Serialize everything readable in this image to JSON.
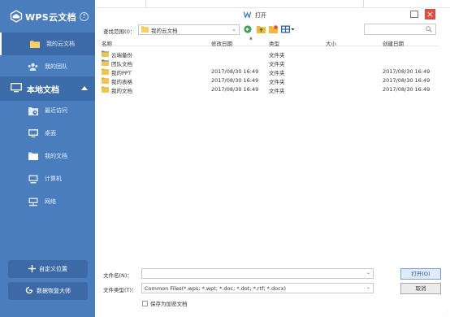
{
  "window": {
    "title": "打开",
    "maximize_icon": "maximize-icon",
    "close_icon": "close-icon",
    "close_color": "#e24a3d"
  },
  "sidebar": {
    "background": "#4a7dbe",
    "brand": {
      "title": "WPS云文档",
      "icon": "cloud-icon",
      "help_icon": "help-icon",
      "help_glyph": "?"
    },
    "items": [
      {
        "label": "我的云文档",
        "icon": "folder-icon",
        "active": true
      },
      {
        "label": "我的团队",
        "icon": "team-icon"
      }
    ],
    "local_section": {
      "label": "本地文档",
      "icon": "monitor-icon",
      "collapse_icon": "caret-up-icon"
    },
    "local_items": [
      {
        "label": "最近访问",
        "icon": "recent-icon"
      },
      {
        "label": "桌面",
        "icon": "desktop-icon"
      },
      {
        "label": "我的文档",
        "icon": "folder-icon"
      },
      {
        "label": "计算机",
        "icon": "computer-icon"
      },
      {
        "label": "网络",
        "icon": "network-icon"
      }
    ],
    "bottom_buttons": [
      {
        "label": "自定义位置",
        "icon": "plus-icon"
      },
      {
        "label": "数据恢复大师",
        "icon": "recovery-icon"
      }
    ]
  },
  "toolbar": {
    "lookin_label": "查找范围(I)：",
    "lookin_value": "我的云文档",
    "icons": [
      "back-icon",
      "up-folder-icon",
      "new-folder-icon",
      "view-menu-icon"
    ],
    "search_icon": "search-icon"
  },
  "file_list": {
    "columns": [
      "名称",
      "修改日期",
      "类型",
      "大小",
      "创建日期"
    ],
    "rows": [
      {
        "name": "云端备份",
        "icon": "cloud-folder-icon",
        "modified": "",
        "type": "文件夹",
        "size": "",
        "created": ""
      },
      {
        "name": "团队文档",
        "icon": "team-folder-icon",
        "modified": "",
        "type": "文件夹",
        "size": "",
        "created": ""
      },
      {
        "name": "我的PPT",
        "icon": "folder-icon",
        "modified": "2017/08/30 16:49",
        "type": "文件夹",
        "size": "",
        "created": "2017/08/30 16:49"
      },
      {
        "name": "我的表格",
        "icon": "folder-icon",
        "modified": "2017/08/30 16:49",
        "type": "文件夹",
        "size": "",
        "created": "2017/08/30 16:49"
      },
      {
        "name": "我的文档",
        "icon": "folder-icon",
        "modified": "2017/08/30 16:49",
        "type": "文件夹",
        "size": "",
        "created": "2017/08/30 16:49"
      }
    ]
  },
  "form": {
    "filename_label": "文件名(N)：",
    "filename_value": "",
    "filetype_label": "文件类型(T)：",
    "filetype_value": "Common Files(*.wps; *.wpt; *.doc; *.dot; *.rtf; *.docx)",
    "open_button": "打开(O)",
    "cancel_button": "取消",
    "encrypt_checkbox": "保存为加密文档"
  }
}
